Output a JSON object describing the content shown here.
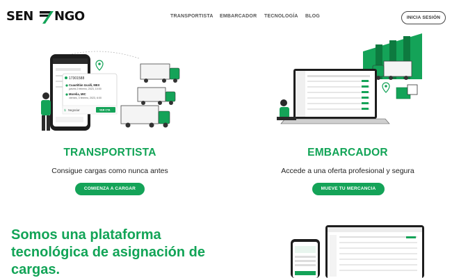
{
  "brand": {
    "name_left": "SEN",
    "name_right": "NGO",
    "accent": "#12a457"
  },
  "nav": {
    "items": [
      "TRANSPORTISTA",
      "EMBARCADOR",
      "TECNOLOGÍA",
      "BLOG"
    ],
    "login_label": "INICIA SESIÓN"
  },
  "cards": [
    {
      "title": "TRANSPORTISTA",
      "subtitle": "Consigue cargas como nunca antes",
      "cta": "COMIENZA A CARGAR",
      "illustration": "trucks-phone-illustration"
    },
    {
      "title": "EMBARCADOR",
      "subtitle": "Accede a una oferta profesional y segura",
      "cta": "MUEVE TU MERCANCIA",
      "illustration": "warehouse-laptop-illustration"
    }
  ],
  "hero": {
    "line1": "Somos una plataforma",
    "line2": "tecnológica de asignación de",
    "line3": "cargas."
  },
  "phone_ui": {
    "id": "17301588",
    "origin": "Cuautitlán Izcalli, MEX",
    "origin_date": "jueves 2 febrero, 2023, 10:00",
    "dest": "Morelia, MIC",
    "dest_date": "viernes, 3 febrero, 2023, 6:00",
    "cta": "Negociar",
    "action": "VER CTA"
  },
  "colors": {
    "green": "#14a358",
    "dark_green": "#0d7a3f",
    "gray": "#d9d9d9"
  }
}
